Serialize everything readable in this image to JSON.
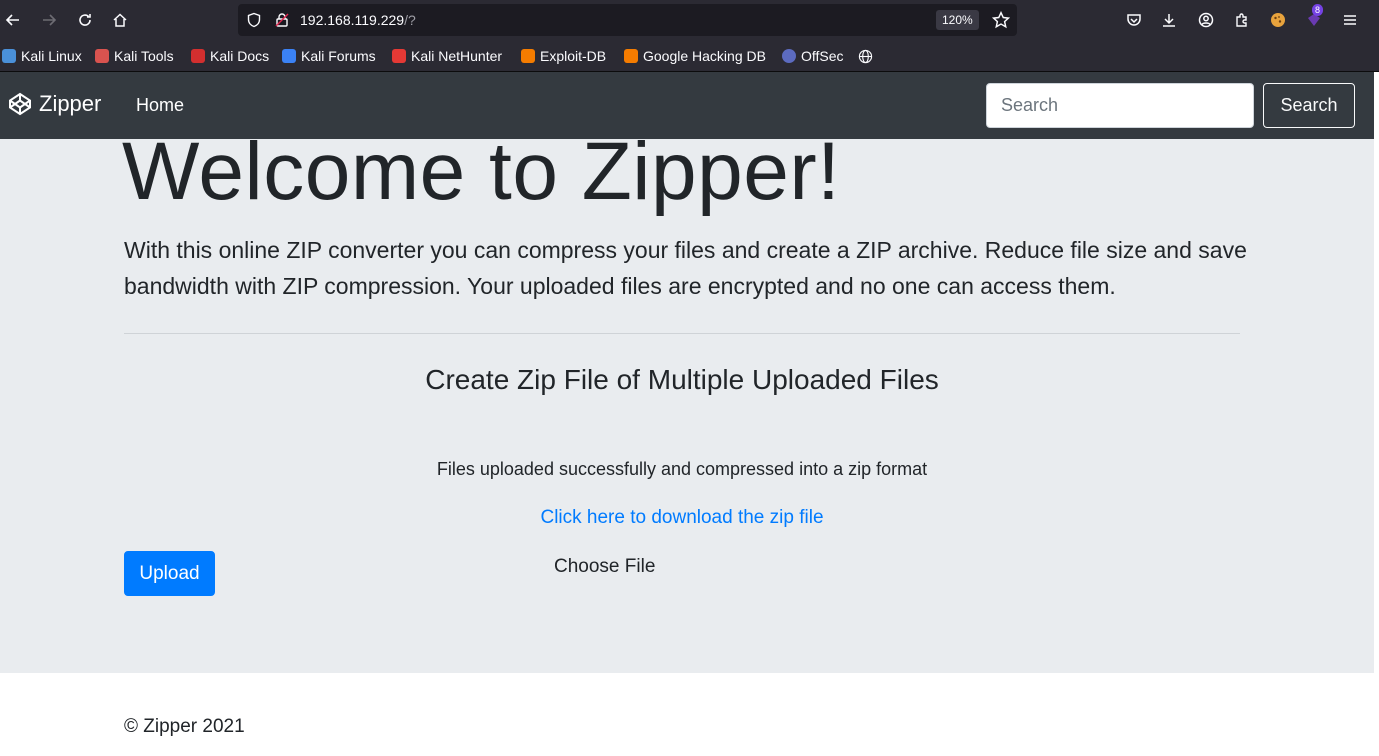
{
  "browser": {
    "url_host": "192.168.119.229",
    "url_path": "/?",
    "zoom": "120%",
    "extension_badge": "8",
    "bookmarks": [
      {
        "label": "Kali Linux",
        "color": "#4a90d9"
      },
      {
        "label": "Kali Tools",
        "color": "#d9534f"
      },
      {
        "label": "Kali Docs",
        "color": "#d32f2f"
      },
      {
        "label": "Kali Forums",
        "color": "#3b82f6"
      },
      {
        "label": "Kali NetHunter",
        "color": "#e53935"
      },
      {
        "label": "Exploit-DB",
        "color": "#f57c00"
      },
      {
        "label": "Google Hacking DB",
        "color": "#f57c00"
      },
      {
        "label": "OffSec",
        "color": "#5c6bc0"
      }
    ]
  },
  "navbar": {
    "brand": "Zipper",
    "home": "Home",
    "search_placeholder": "Search",
    "search_button": "Search"
  },
  "main": {
    "heading": "Welcome to Zipper!",
    "lead": "With this online ZIP converter you can compress your files and create a ZIP archive. Reduce file size and save bandwidth with ZIP compression. Your uploaded files are encrypted and no one can access them.",
    "section_title": "Create Zip File of Multiple Uploaded Files",
    "status": "Files uploaded successfully and compressed into a zip format",
    "download_link": "Click here to download the zip file",
    "upload_button": "Upload",
    "choose_file": "Choose File"
  },
  "footer": {
    "copyright": "© Zipper 2021"
  },
  "colors": {
    "navbar_bg": "#343a40",
    "jumbotron_bg": "#e9ecef",
    "primary": "#007bff"
  }
}
